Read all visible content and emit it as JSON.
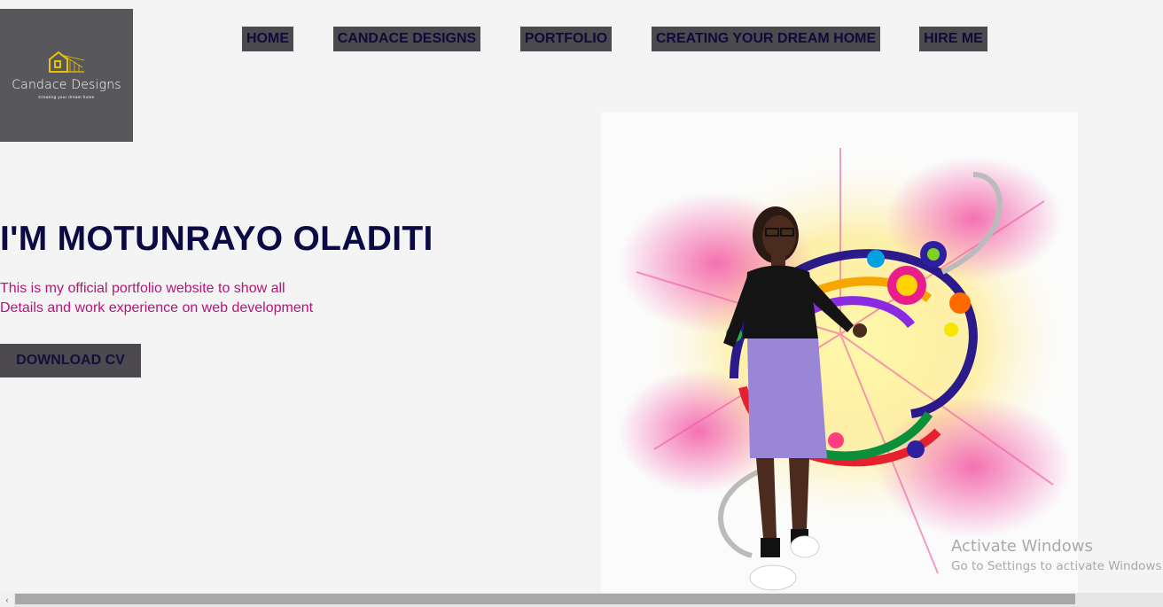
{
  "logo": {
    "brand": "Candace Designs",
    "tagline": "Creating your dream home",
    "icon": "house-icon",
    "colors": {
      "background": "#58575c",
      "accent": "#e8c400"
    }
  },
  "nav": {
    "items": [
      {
        "label": "HOME"
      },
      {
        "label": "CANDACE DESIGNS"
      },
      {
        "label": "PORTFOLIO"
      },
      {
        "label": "CREATING YOUR DREAM HOME"
      },
      {
        "label": "HIRE ME"
      }
    ]
  },
  "hero": {
    "title": "I'M MOTUNRAYO OLADITI",
    "description_line1": "This is my official portfolio website to show all",
    "description_line2": "Details and work experience on web development",
    "cv_button": "DOWNLOAD CV",
    "image": "portrait-with-colorful-swirl-background"
  },
  "watermark": {
    "title": "Activate Windows",
    "subtitle": "Go to Settings to activate Windows."
  },
  "scrollbar": {
    "left_arrow": "‹",
    "icon": "chevron-left-icon"
  },
  "colors": {
    "page_bg": "#f4f4f4",
    "nav_bg": "#4c4a4f",
    "title": "#0b0a44",
    "description": "#b5157a"
  }
}
